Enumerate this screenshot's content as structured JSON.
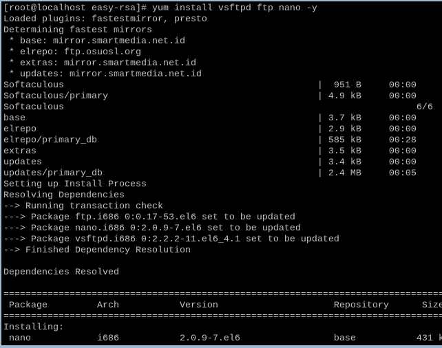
{
  "terminal": {
    "background": "#000000",
    "foreground": "#c0c0c0",
    "lines": [
      "[root@localhost easy-rsa]# yum install vsftpd ftp nano -y",
      "Loaded plugins: fastestmirror, presto",
      "Determining fastest mirrors",
      " * base: mirror.smartmedia.net.id",
      " * elrepo: ftp.osuosl.org",
      " * extras: mirror.smartmedia.net.id",
      " * updates: mirror.smartmedia.net.id",
      "Softaculous                                              |  951 B     00:00",
      "Softaculous/primary                                      | 4.9 kB     00:00",
      "Softaculous                                                                6/6",
      "base                                                     | 3.7 kB     00:00",
      "elrepo                                                   | 2.9 kB     00:00",
      "elrepo/primary_db                                        | 585 kB     00:28",
      "extras                                                   | 3.5 kB     00:00",
      "updates                                                  | 3.4 kB     00:00",
      "updates/primary_db                                       | 2.4 MB     00:05",
      "Setting up Install Process",
      "Resolving Dependencies",
      "--> Running transaction check",
      "---> Package ftp.i686 0:0.17-53.el6 set to be updated",
      "---> Package nano.i686 0:2.0.9-7.el6 set to be updated",
      "---> Package vsftpd.i686 0:2.2.2-11.el6_4.1 set to be updated",
      "--> Finished Dependency Resolution",
      "",
      "Dependencies Resolved",
      "",
      "================================================================================",
      " Package         Arch           Version                     Repository      Size",
      "================================================================================",
      "Installing:",
      " nano            i686           2.0.9-7.el6                 base           431 k"
    ]
  }
}
